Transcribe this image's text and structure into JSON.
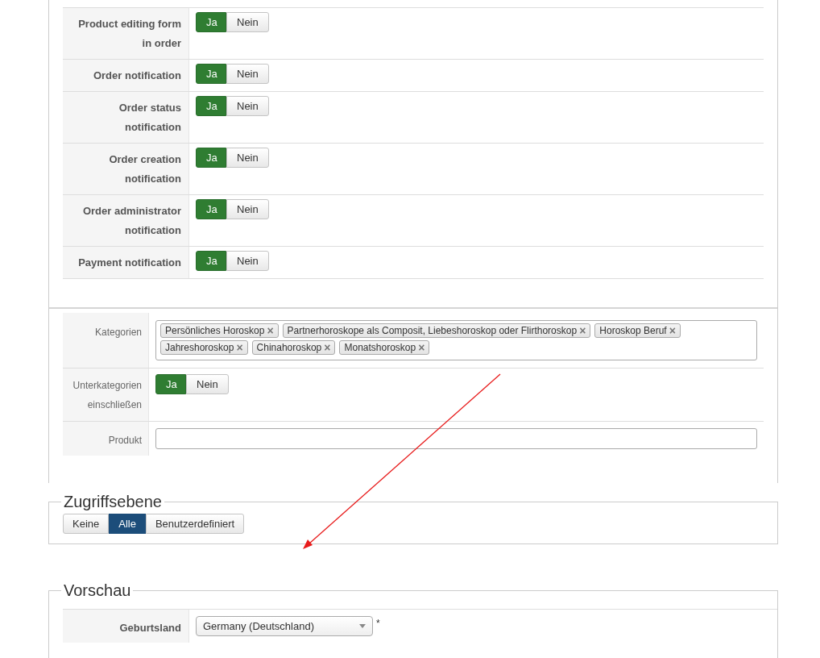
{
  "notification_settings": [
    {
      "label": "Product editing form in order",
      "options": [
        {
          "label": "Ja",
          "selected": true
        },
        {
          "label": "Nein",
          "selected": false
        }
      ]
    },
    {
      "label": "Order notification",
      "options": [
        {
          "label": "Ja",
          "selected": true
        },
        {
          "label": "Nein",
          "selected": false
        }
      ]
    },
    {
      "label": "Order status notification",
      "options": [
        {
          "label": "Ja",
          "selected": true
        },
        {
          "label": "Nein",
          "selected": false
        }
      ]
    },
    {
      "label": "Order creation notification",
      "options": [
        {
          "label": "Ja",
          "selected": true
        },
        {
          "label": "Nein",
          "selected": false
        }
      ]
    },
    {
      "label": "Order administrator notification",
      "options": [
        {
          "label": "Ja",
          "selected": true
        },
        {
          "label": "Nein",
          "selected": false
        }
      ]
    },
    {
      "label": "Payment notification",
      "options": [
        {
          "label": "Ja",
          "selected": true
        },
        {
          "label": "Nein",
          "selected": false
        }
      ]
    }
  ],
  "filter": {
    "categories": {
      "label": "Kategorien",
      "tags": [
        {
          "label": "Persönliches Horoskop",
          "remove": "×"
        },
        {
          "label": "Partnerhoroskope als Composit, Liebeshoroskop oder Flirthoroskop",
          "remove": "×"
        },
        {
          "label": "Horoskop Beruf",
          "remove": "×"
        },
        {
          "label": "Jahreshoroskop",
          "remove": "×"
        },
        {
          "label": "Chinahoroskop",
          "remove": "×"
        },
        {
          "label": "Monatshoroskop",
          "remove": "×"
        }
      ]
    },
    "subcategories": {
      "label": "Unterkategorien einschließen",
      "options": [
        {
          "label": "Ja",
          "selected": true
        },
        {
          "label": "Nein",
          "selected": false
        }
      ]
    },
    "product": {
      "label": "Produkt"
    }
  },
  "access_level": {
    "title": "Zugriffsebene",
    "options": [
      {
        "label": "Keine",
        "selected": false
      },
      {
        "label": "Alle",
        "selected": true
      },
      {
        "label": "Benutzerdefiniert",
        "selected": false
      }
    ]
  },
  "preview": {
    "title": "Vorschau",
    "field": {
      "label": "Geburtsland",
      "value": "Germany (Deutschland)",
      "required_mark": "*"
    }
  }
}
